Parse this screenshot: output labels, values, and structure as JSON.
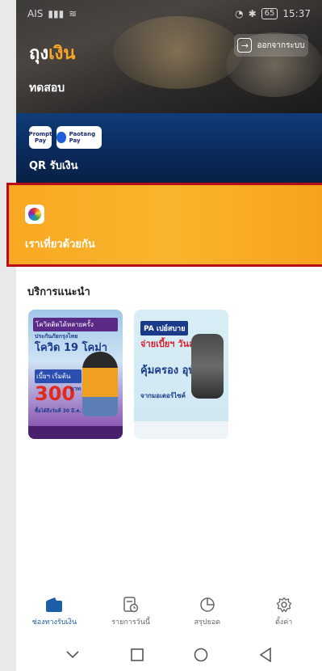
{
  "status_bar": {
    "carrier": "AIS",
    "battery": "65",
    "time": "15:37"
  },
  "header": {
    "logo_prefix": "ถุง",
    "logo_highlight": "เงิน",
    "logout_label": "ออกจากระบบ",
    "shop_name": "ทดสอบ"
  },
  "qr_card": {
    "badges": [
      "Prompt Pay",
      "Paotang Pay"
    ],
    "label": "QR รับเงิน"
  },
  "tour_card": {
    "label": "เราเที่ยวด้วยกัน"
  },
  "services": {
    "title": "บริการแนะนำ",
    "promos": [
      {
        "title": "โควิดติดได้หลายครั้ง",
        "subtitle": "ประกันภัยกรุงไทย",
        "big_text": "โควิด 19 โคม่า",
        "note": "(จากการติดเชื้อโควิด)",
        "mid_label": "เบี้ยฯ เริ่มต้น",
        "number": "300",
        "unit": "บาท ต่อปี",
        "date": "ซื้อได้ถึงวันที่ 30 มี.ค. 66"
      },
      {
        "title": "PA เปย์สบาย",
        "red_text": "จ่ายเบี้ยฯ วันละบาท",
        "blue_text": "คุ้มครอง อุบัติเหตุ",
        "small_text": "จากมอเตอร์ไซค์"
      }
    ]
  },
  "bottom_nav": {
    "items": [
      {
        "label": "ช่องทางรับเงิน",
        "icon": "wallet-icon",
        "active": true
      },
      {
        "label": "รายการวันนี้",
        "icon": "receipt-clock-icon",
        "active": false
      },
      {
        "label": "สรุปยอด",
        "icon": "pie-chart-icon",
        "active": false
      },
      {
        "label": "ตั้งค่า",
        "icon": "gear-icon",
        "active": false
      }
    ]
  },
  "system_nav": {
    "buttons": [
      "back-chevron-icon",
      "recents-square-icon",
      "home-circle-icon",
      "back-triangle-icon"
    ]
  },
  "colors": {
    "accent": "#1a5fa8",
    "tour_orange": "#f8b52c",
    "tour_border": "#b70d18",
    "qr_navy": "#0a2a5a"
  }
}
